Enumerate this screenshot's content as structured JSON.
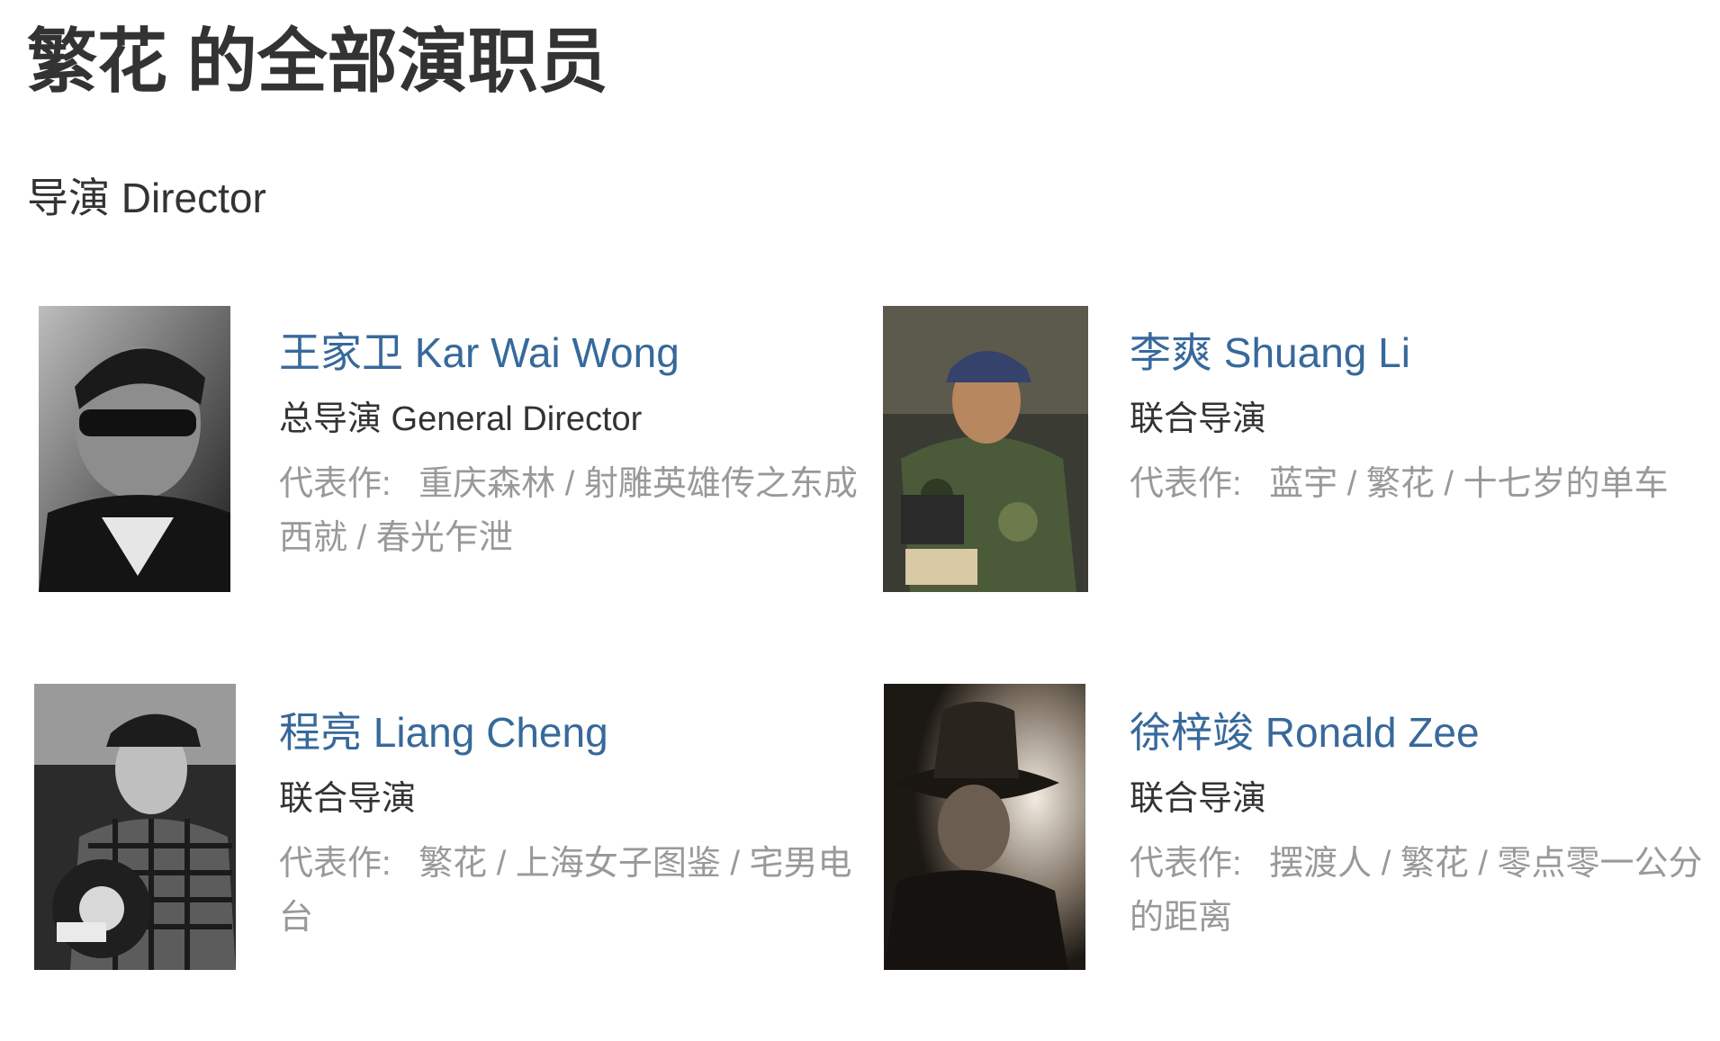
{
  "page": {
    "title": "繁花 的全部演职员"
  },
  "section": {
    "title": "导演 Director"
  },
  "people": [
    {
      "name": "王家卫 Kar Wai Wong",
      "role": "总导演 General Director",
      "works_label": "代表作:",
      "works": [
        "重庆森林",
        "射雕英雄传之东成西就",
        "春光乍泄"
      ],
      "photo": "director-photo-grayscale"
    },
    {
      "name": "李爽 Shuang Li",
      "role": "联合导演",
      "works_label": "代表作:",
      "works": [
        "蓝宇",
        "繁花",
        "十七岁的单车"
      ],
      "photo": "director-photo-color"
    },
    {
      "name": "程亮 Liang Cheng",
      "role": "联合导演",
      "works_label": "代表作:",
      "works": [
        "繁花",
        "上海女子图鉴",
        "宅男电台"
      ],
      "photo": "director-photo-grayscale"
    },
    {
      "name": "徐梓竣 Ronald Zee",
      "role": "联合导演",
      "works_label": "代表作:",
      "works": [
        "摆渡人",
        "繁花",
        "零点零一公分的距离"
      ],
      "photo": "director-photo-sepia"
    }
  ],
  "colors": {
    "link": "#37699b",
    "text": "#333333",
    "muted": "#999999"
  }
}
